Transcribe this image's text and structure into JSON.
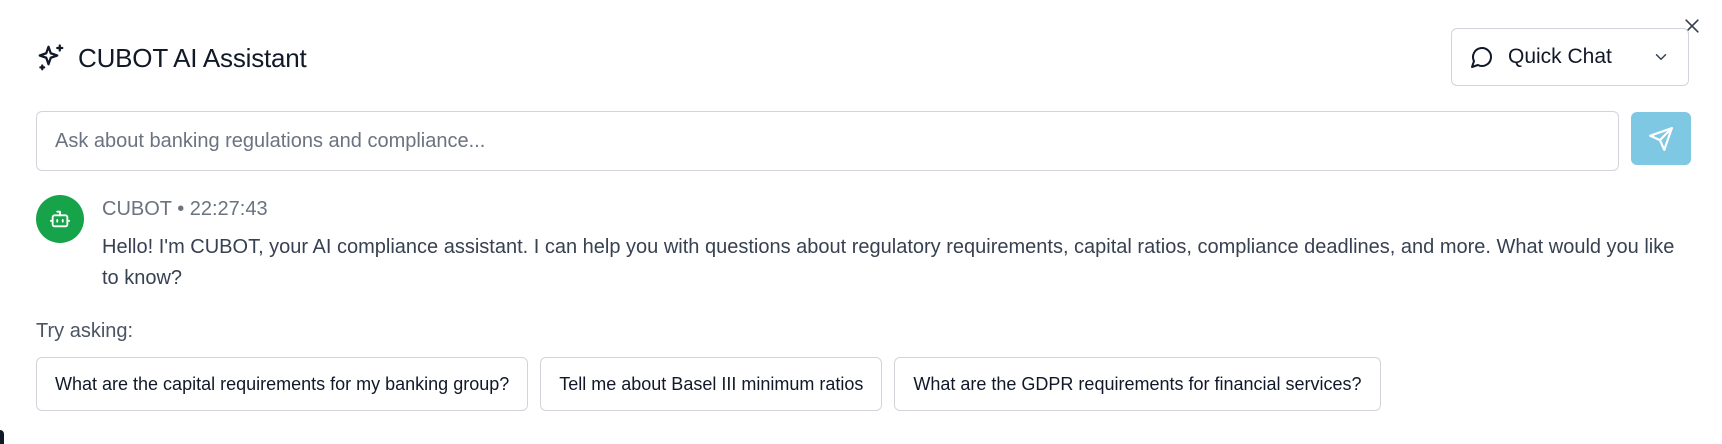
{
  "header": {
    "title": "CUBOT AI Assistant",
    "icon": "sparkles-icon"
  },
  "mode_select": {
    "selected": "Quick Chat",
    "icon": "message-circle-icon"
  },
  "ask": {
    "placeholder": "Ask about banking regulations and compliance...",
    "value": "",
    "send_color": "#7ec8e3"
  },
  "message": {
    "sender": "CUBOT",
    "time": "22:27:43",
    "meta": "CUBOT • 22:27:43",
    "text": "Hello! I'm CUBOT, your AI compliance assistant. I can help you with questions about regulatory requirements, capital ratios, compliance deadlines, and more. What would you like to know?",
    "avatar_color": "#16a34a",
    "avatar_icon": "bot-icon"
  },
  "suggestions": {
    "label": "Try asking:",
    "items": [
      "What are the capital requirements for my banking group?",
      "Tell me about Basel III minimum ratios",
      "What are the GDPR requirements for financial services?"
    ]
  }
}
